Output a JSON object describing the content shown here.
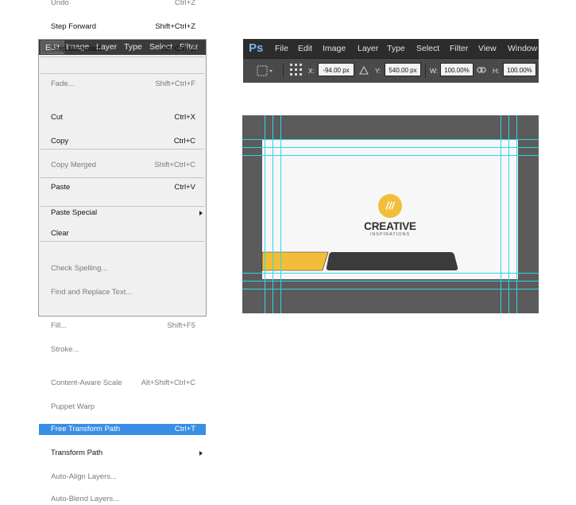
{
  "edit_menu": {
    "menubar": [
      "Edit",
      "Image",
      "Layer",
      "Type",
      "Select",
      "Filter"
    ],
    "items": [
      {
        "label": "Undo",
        "shortcut": "Ctrl+Z",
        "enabled": false
      },
      {
        "label": "Step Forward",
        "shortcut": "Shift+Ctrl+Z",
        "enabled": true
      },
      {
        "label": "Step Backward",
        "shortcut": "Alt+Ctrl+Z",
        "enabled": true
      },
      {
        "label": "Fade...",
        "shortcut": "Shift+Ctrl+F",
        "enabled": false
      },
      {
        "label": "Cut",
        "shortcut": "Ctrl+X",
        "enabled": true
      },
      {
        "label": "Copy",
        "shortcut": "Ctrl+C",
        "enabled": true
      },
      {
        "label": "Copy Merged",
        "shortcut": "Shift+Ctrl+C",
        "enabled": false
      },
      {
        "label": "Paste",
        "shortcut": "Ctrl+V",
        "enabled": true
      },
      {
        "label": "Paste Special",
        "shortcut": "",
        "enabled": true,
        "submenu": true
      },
      {
        "label": "Clear",
        "shortcut": "",
        "enabled": true
      },
      {
        "label": "Check Spelling...",
        "shortcut": "",
        "enabled": false
      },
      {
        "label": "Find and Replace Text...",
        "shortcut": "",
        "enabled": false
      },
      {
        "label": "Fill...",
        "shortcut": "Shift+F5",
        "enabled": false
      },
      {
        "label": "Stroke...",
        "shortcut": "",
        "enabled": false
      },
      {
        "label": "Content-Aware Scale",
        "shortcut": "Alt+Shift+Ctrl+C",
        "enabled": false
      },
      {
        "label": "Puppet Warp",
        "shortcut": "",
        "enabled": false
      },
      {
        "label": "Free Transform Path",
        "shortcut": "Ctrl+T",
        "enabled": true,
        "highlighted": true
      },
      {
        "label": "Transform Path",
        "shortcut": "",
        "enabled": true,
        "submenu": true
      },
      {
        "label": "Auto-Align Layers...",
        "shortcut": "",
        "enabled": false
      },
      {
        "label": "Auto-Blend Layers...",
        "shortcut": "",
        "enabled": false
      }
    ]
  },
  "topbar": {
    "logo": "Ps",
    "menu": [
      "File",
      "Edit",
      "Image",
      "Layer",
      "Type",
      "Select",
      "Filter",
      "View",
      "Window"
    ],
    "options": {
      "x_label": "X:",
      "x_value": "-94.00 px",
      "y_label": "Y:",
      "y_value": "540.00 px",
      "w_label": "W:",
      "w_value": "100.00%",
      "h_label": "H:",
      "h_value": "100.00%"
    }
  },
  "canvas": {
    "logo_mark": "///",
    "brand_name": "CREATIVE",
    "brand_tagline": "INSPIRATIONS",
    "accent_color": "#f2be3a",
    "dark_color": "#3b3b3b",
    "guide_color": "#2fd6e6"
  }
}
